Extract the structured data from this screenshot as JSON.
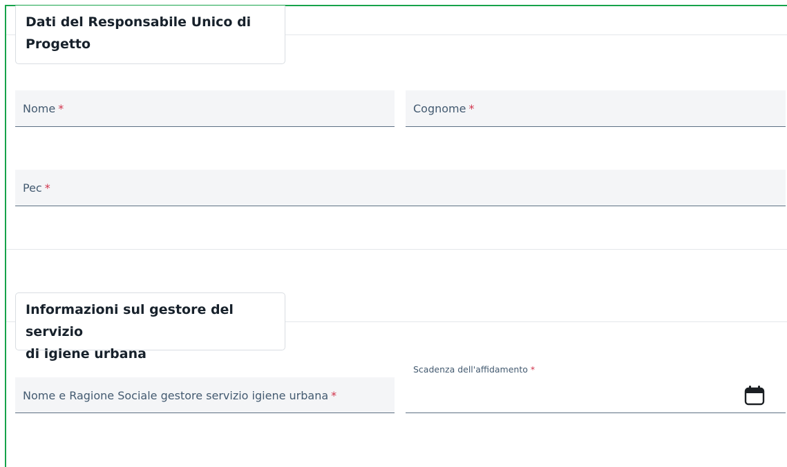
{
  "sections": [
    {
      "title_line1": "Dati del Responsabile Unico di",
      "title_line2": "Progetto"
    },
    {
      "title_line1": "Informazioni sul gestore del servizio",
      "title_line2": "di igiene urbana"
    }
  ],
  "fields": {
    "nome": {
      "label": "Nome",
      "required_mark": "*"
    },
    "cognome": {
      "label": "Cognome",
      "required_mark": "*"
    },
    "pec": {
      "label": "Pec",
      "required_mark": "*"
    },
    "gestore": {
      "label": "Nome e Ragione Sociale gestore servizio igiene urbana",
      "required_mark": "*"
    },
    "scadenza": {
      "label": "Scadenza dell'affidamento",
      "required_mark": "*",
      "icon": "calendar-icon"
    }
  },
  "colors": {
    "frame_border": "#16a34a",
    "required": "#d1344c",
    "label": "#435a70",
    "field_background": "#f4f5f7"
  }
}
